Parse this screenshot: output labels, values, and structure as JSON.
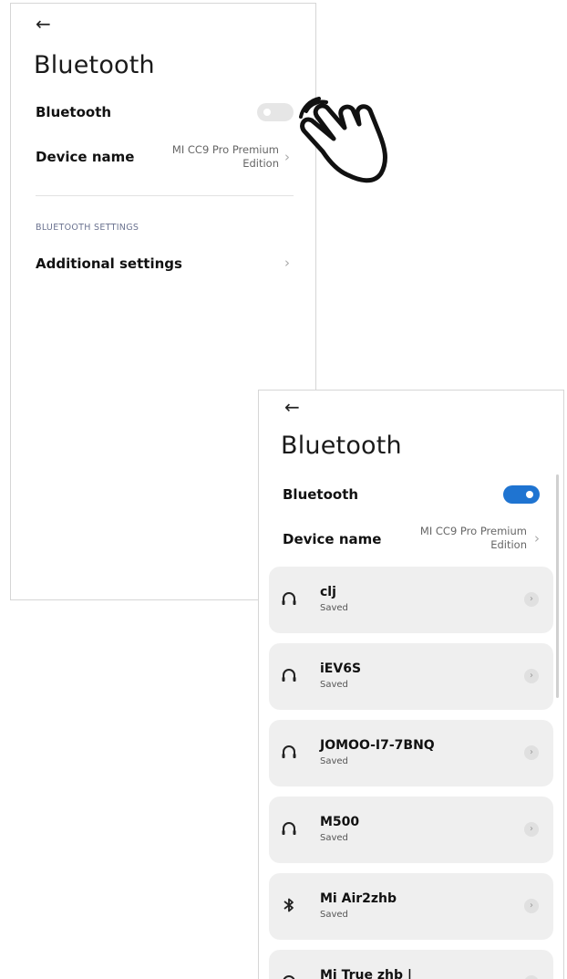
{
  "screen_before": {
    "back_glyph": "←",
    "title": "Bluetooth",
    "bluetooth_label": "Bluetooth",
    "bluetooth_enabled": false,
    "device_name_label": "Device name",
    "device_name_line1": "MI CC9 Pro Premium",
    "device_name_line2": "Edition",
    "section_header": "BLUETOOTH SETTINGS",
    "additional_settings_label": "Additional settings"
  },
  "screen_after": {
    "back_glyph": "←",
    "title": "Bluetooth",
    "bluetooth_label": "Bluetooth",
    "bluetooth_enabled": true,
    "device_name_label": "Device name",
    "device_name_line1": "MI CC9 Pro Premium",
    "device_name_line2": "Edition",
    "devices": [
      {
        "name": "clj",
        "status": "Saved",
        "icon": "headphones-icon"
      },
      {
        "name": "iEV6S",
        "status": "Saved",
        "icon": "headphones-icon"
      },
      {
        "name": "JOMOO-I7-7BNQ",
        "status": "Saved",
        "icon": "headphones-icon"
      },
      {
        "name": "M500",
        "status": "Saved",
        "icon": "headphones-icon"
      },
      {
        "name": "Mi Air2zhb",
        "status": "Saved",
        "icon": "bluetooth-icon"
      },
      {
        "name": "Mi True zhb |",
        "status": "",
        "icon": "headphones-icon"
      }
    ]
  },
  "colors": {
    "toggle_on": "#1f74d1",
    "toggle_off": "#e6e6e6",
    "card_bg": "#efefef"
  }
}
